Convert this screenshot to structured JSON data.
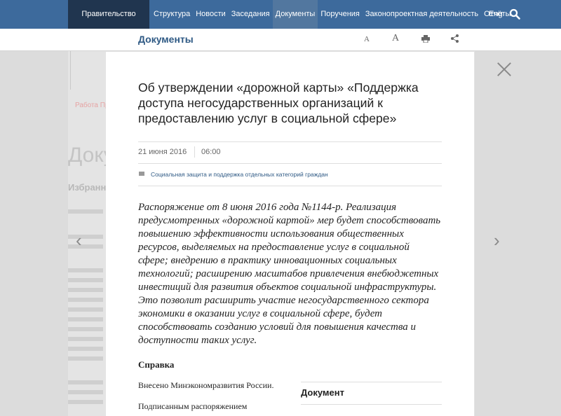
{
  "nav": {
    "home": "Правительство России",
    "items": [
      "Структура",
      "Новости",
      "Заседания",
      "Документы",
      "Поручения",
      "Законопроектная деятельность",
      "Отчёты"
    ],
    "lang": "Eng"
  },
  "docbar": {
    "title": "Документы"
  },
  "background": {
    "tab": "Работа Пр",
    "big": "Доку",
    "sub": "Избранн"
  },
  "modal": {
    "title": "Об утверждении «дорожной карты» «Поддержка доступа негосударственных организаций к предоставлению услуг в социальной сфере»",
    "date": "21 июня 2016",
    "time": "06:00",
    "category": "Социальная защита и поддержка отдельных категорий граждан",
    "body": "Распоряжение от 8 июня 2016 года №1144-р. Реализация предусмотренных «дорожной картой» мер будет способствовать повышению эффективности использования общественных ресурсов, выделяемых на предоставление услуг в социальной сфере; внедрению в практику инновационных социальных технологий; расширению масштабов привлечения внебюджетных инвестиций для развития объектов социальной инфраструктуры. Это позволит расширить участие негосударственного сектора экономики в оказании услуг в социальной сфере, будет способствовать созданию условий для повышения качества и доступности таких услуг.",
    "reference_heading": "Справка",
    "submitted": "Внесено Минэкономразвития России.",
    "signed": "Подписанным распоряжением",
    "document_heading": "Документ"
  },
  "colors": {
    "nav": "#3d6a9c",
    "nav_home": "#20354f",
    "accent": "#2e5984"
  }
}
